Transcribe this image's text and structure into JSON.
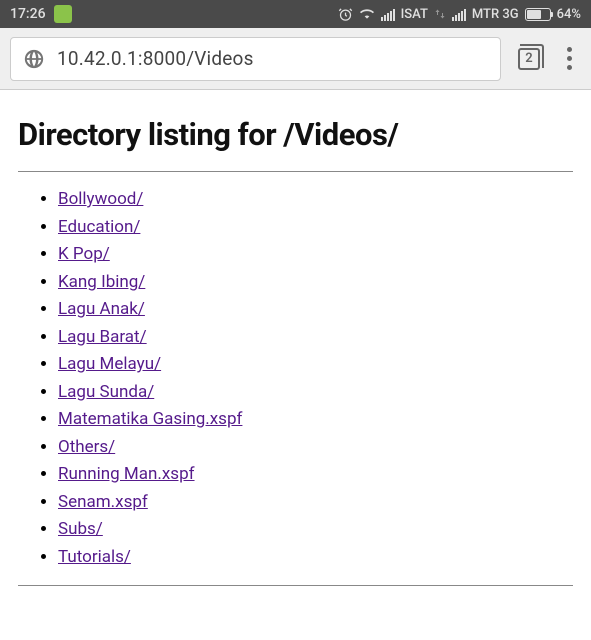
{
  "status": {
    "time": "17:26",
    "carrier1": "ISAT",
    "carrier2": "MTR 3G",
    "battery_pct": "64%"
  },
  "browser": {
    "url": "10.42.0.1:8000/Videos",
    "tab_count": "2"
  },
  "page": {
    "title": "Directory listing for /Videos/",
    "items": [
      "Bollywood/",
      "Education/",
      "K Pop/",
      "Kang Ibing/",
      "Lagu Anak/",
      "Lagu Barat/",
      "Lagu Melayu/",
      "Lagu Sunda/",
      "Matematika Gasing.xspf",
      "Others/",
      "Running Man.xspf",
      "Senam.xspf",
      "Subs/",
      "Tutorials/"
    ]
  }
}
